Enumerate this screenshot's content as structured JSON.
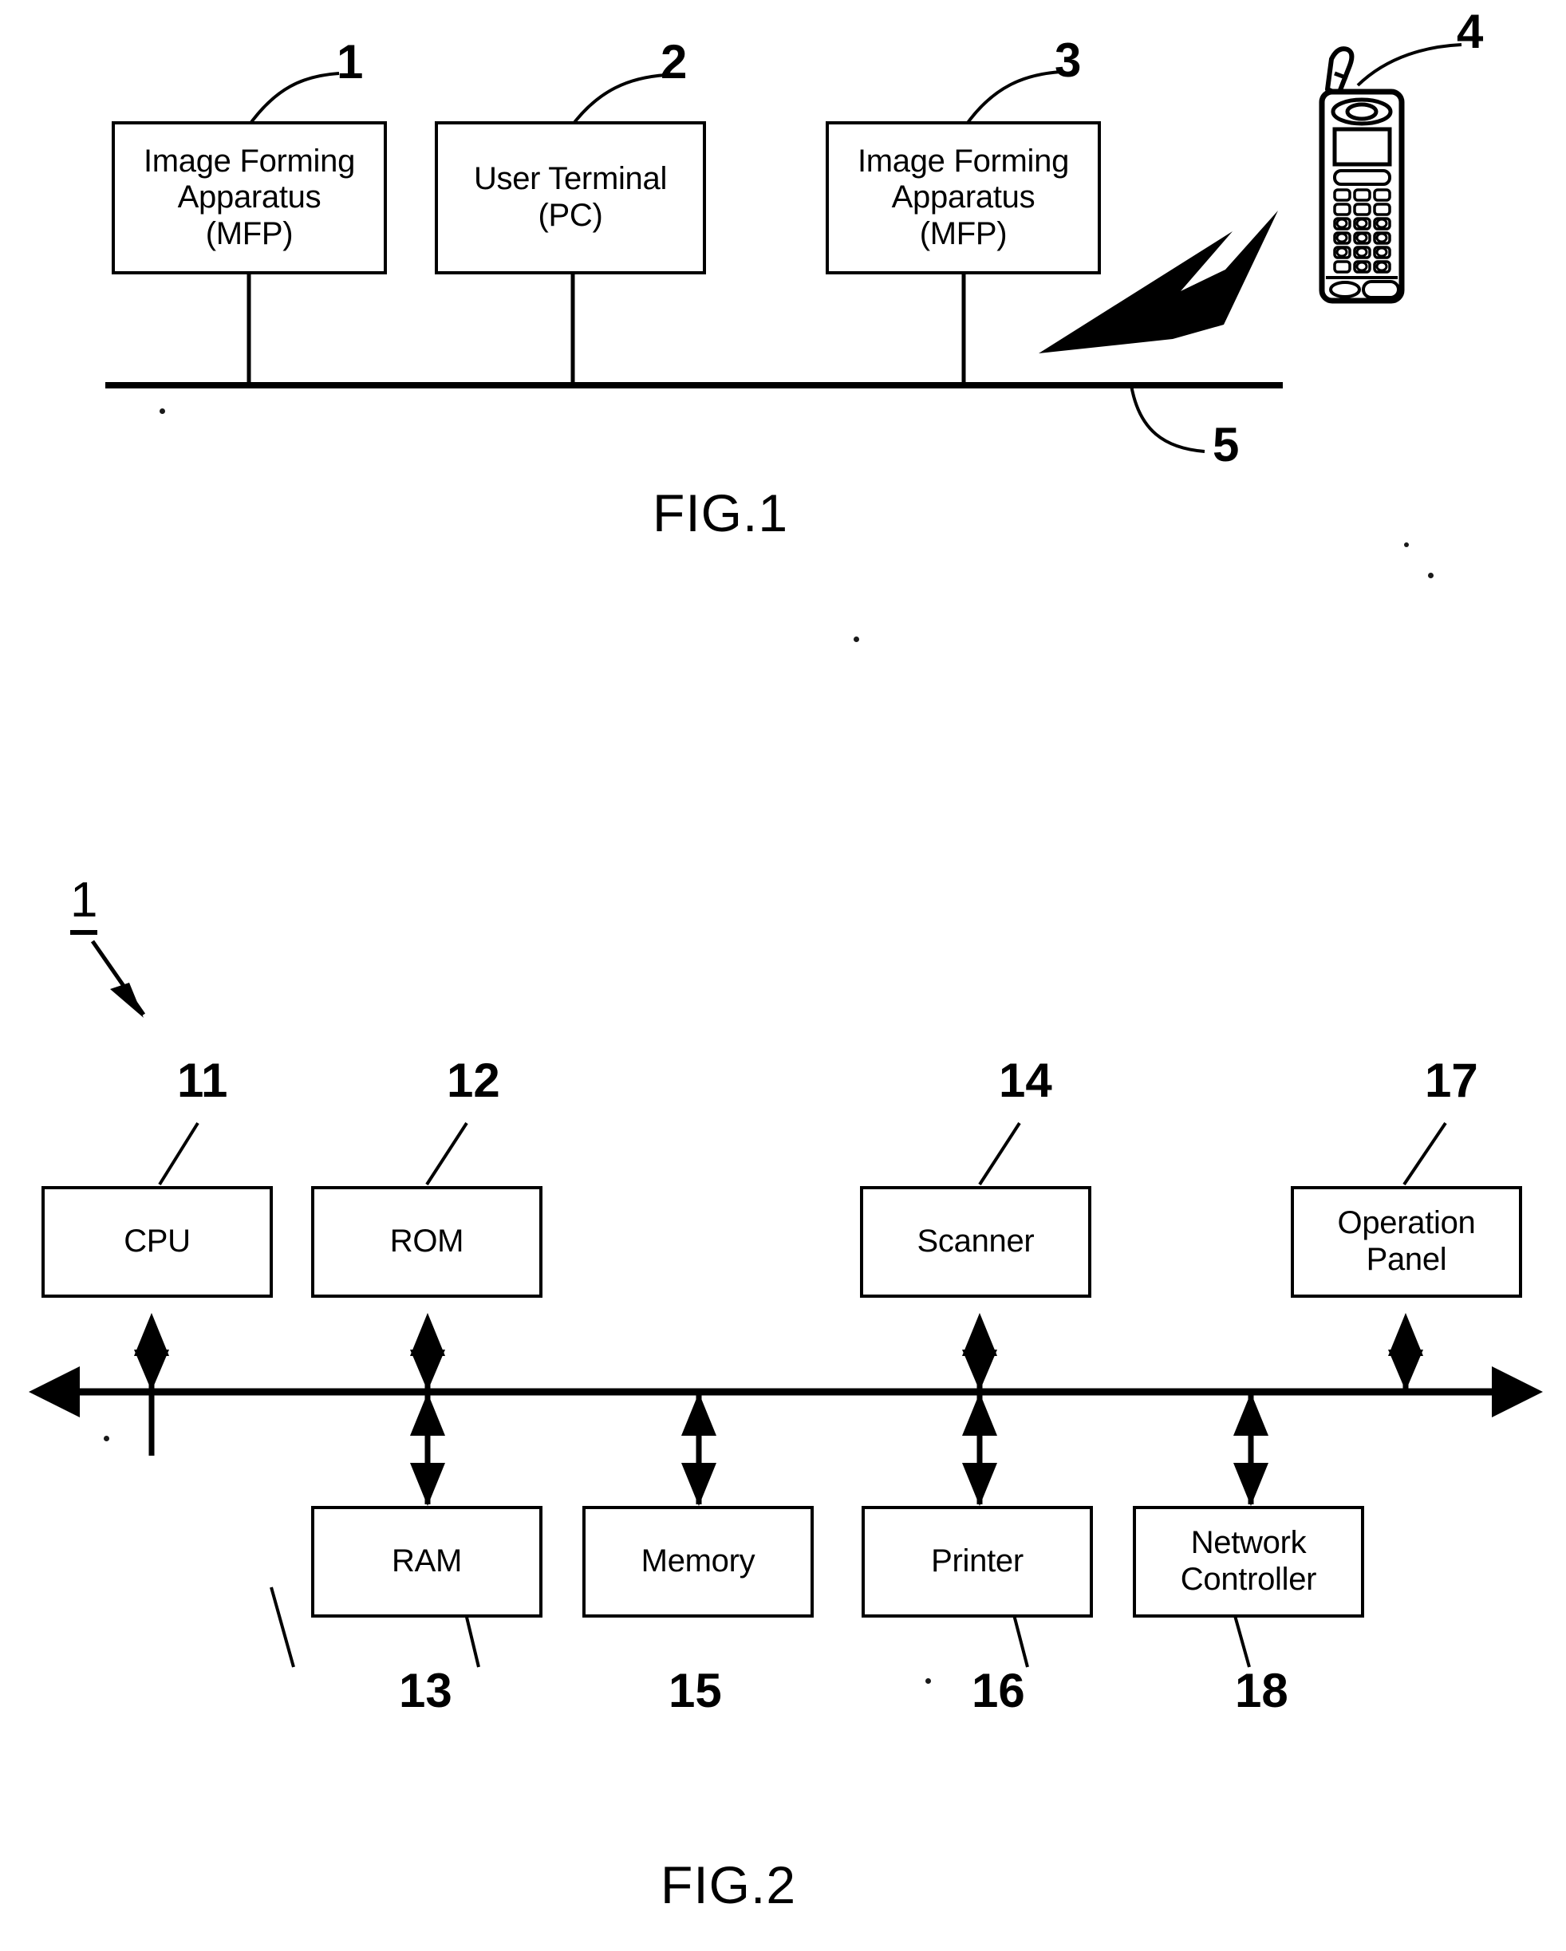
{
  "document": {
    "type": "patent-drawing-sheet",
    "ink_color": "#000000",
    "background_color": "#ffffff"
  },
  "figure1": {
    "caption": "FIG.1",
    "nodes": [
      {
        "id": "mfp-left",
        "label": "Image Forming\nApparatus\n(MFP)",
        "ref": "1"
      },
      {
        "id": "pc",
        "label": "User Terminal\n(PC)",
        "ref": "2"
      },
      {
        "id": "mfp-right",
        "label": "Image Forming\nApparatus\n(MFP)",
        "ref": "3"
      }
    ],
    "mobile_terminal": {
      "ref": "4",
      "keypad_rows": 6,
      "keypad_cols": 3
    },
    "network": {
      "ref": "5",
      "wireless_link": "lightning-bolt"
    }
  },
  "figure2": {
    "caption": "FIG.2",
    "assembly_ref": "1",
    "bus": {
      "style": "double-headed-horizontal-arrow"
    },
    "top_nodes": [
      {
        "id": "cpu",
        "label": "CPU",
        "ref": "11"
      },
      {
        "id": "rom",
        "label": "ROM",
        "ref": "12"
      },
      {
        "id": "scanner",
        "label": "Scanner",
        "ref": "14"
      },
      {
        "id": "operation",
        "label": "Operation\nPanel",
        "ref": "17"
      }
    ],
    "bottom_nodes": [
      {
        "id": "ram",
        "label": "RAM",
        "ref": "13"
      },
      {
        "id": "memory",
        "label": "Memory",
        "ref": "15"
      },
      {
        "id": "printer",
        "label": "Printer",
        "ref": "16"
      },
      {
        "id": "netctrl",
        "label": "Network\nController",
        "ref": "18"
      }
    ]
  }
}
